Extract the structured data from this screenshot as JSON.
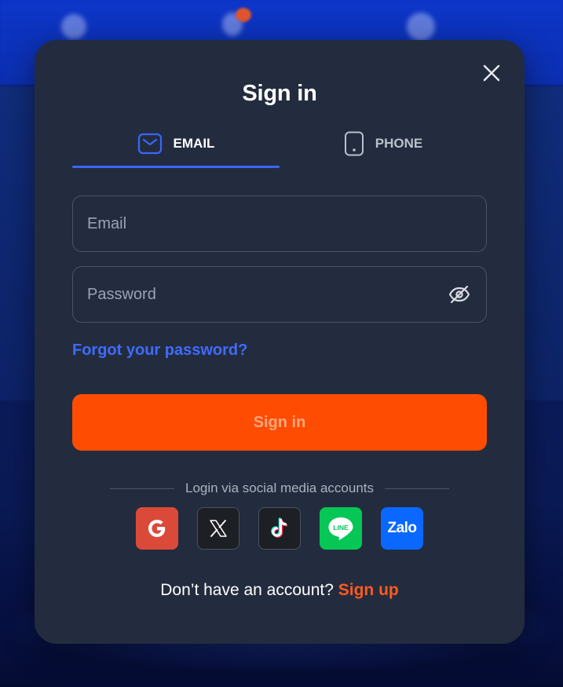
{
  "modal": {
    "title": "Sign in",
    "close_icon": "close-icon"
  },
  "tabs": [
    {
      "label": "EMAIL",
      "icon": "envelope-icon",
      "active": true
    },
    {
      "label": "PHONE",
      "icon": "smartphone-icon",
      "active": false
    }
  ],
  "form": {
    "email_placeholder": "Email",
    "email_value": "",
    "password_placeholder": "Password",
    "password_value": "",
    "password_toggle_icon": "eye-off-icon",
    "forgot_label": "Forgot your password?",
    "submit_label": "Sign in"
  },
  "social": {
    "caption": "Login via social media accounts",
    "providers": [
      {
        "name": "google",
        "icon": "google-icon",
        "color": "#db4a39"
      },
      {
        "name": "x",
        "icon": "x-icon",
        "color": "#1c1f24"
      },
      {
        "name": "tiktok",
        "icon": "tiktok-icon",
        "color": "#1c1f24"
      },
      {
        "name": "line",
        "icon": "line-icon",
        "color": "#06c755",
        "label": "LINE"
      },
      {
        "name": "zalo",
        "icon": "zalo-icon",
        "color": "#0a68ff",
        "label": "Zalo"
      }
    ]
  },
  "footer": {
    "question": "Don’t have an account?",
    "signup_label": "Sign up"
  },
  "colors": {
    "modal_bg": "#232c3e",
    "accent_blue": "#3866ff",
    "primary_orange": "#fe4c03",
    "signup_orange": "#ff5a1f"
  }
}
